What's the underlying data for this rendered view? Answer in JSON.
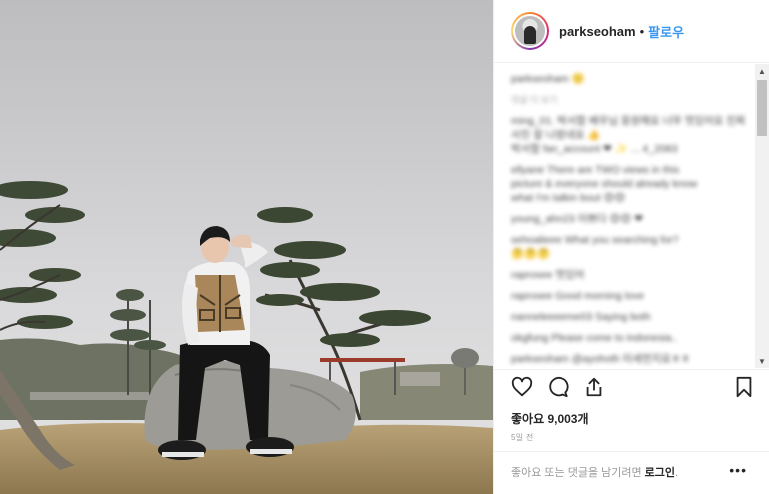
{
  "post": {
    "username": "parkseoham",
    "separator": "•",
    "follow_label": "팔로우"
  },
  "comments": [
    {
      "text": "parkseoham 🙂",
      "muted": false
    },
    {
      "text": "댓글 더 보기",
      "muted": true
    },
    {
      "text": "ming_01. 박서함 배우님 응원해요 너무 멋있어요 진짜",
      "muted": false
    },
    {
      "text": "사진 잘 나왔네요 👍",
      "muted": false
    },
    {
      "text": "박서함 fan_account ❤ ✨ ... 4_2083",
      "muted": false
    },
    {
      "text": "ellyane There are TWO views in this",
      "muted": false
    },
    {
      "text": "picture & everyone should already know",
      "muted": false
    },
    {
      "text": "what I'm talkin bout 😍😍",
      "muted": false
    },
    {
      "text": "young_ahn23 이쁘다 😍😍 ❤",
      "muted": false
    },
    {
      "text": "sehoalieee What you searching for?",
      "muted": false
    },
    {
      "text": "🤔🤔🤔",
      "muted": false
    },
    {
      "text": "raprosee 멋있어",
      "muted": false
    },
    {
      "text": "raprosee Good morning love",
      "muted": false
    },
    {
      "text": "nanneleeeeme03 Saying both",
      "muted": false
    },
    {
      "text": "okgfung Please come to indonesia..",
      "muted": false
    },
    {
      "text": "parkseoham @ayohoth 미세먼지요ㅎㅎ",
      "muted": false
    }
  ],
  "actions": {
    "like_icon": "heart-outline",
    "comment_icon": "speech-bubble",
    "share_icon": "share-upload",
    "save_icon": "bookmark-outline"
  },
  "likes_label": "좋아요 9,003개",
  "time_ago": "5일 전",
  "footer": {
    "prompt": "좋아요 또는 댓글을 남기려면",
    "login_label": "로그인",
    "suffix": ".",
    "more_label": "•••"
  },
  "colors": {
    "accent": "#3897f0",
    "text": "#262626",
    "muted": "#999999"
  }
}
